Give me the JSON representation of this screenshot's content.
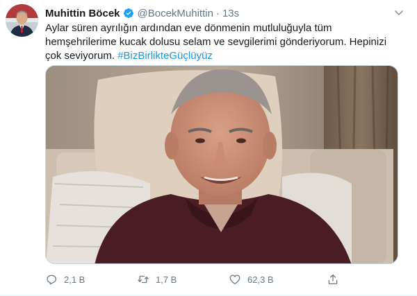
{
  "user": {
    "name": "Muhittin Böcek",
    "handle": "@BocekMuhittin",
    "separator": "·",
    "time": "13s"
  },
  "tweet": {
    "line1": "Aylar süren ayrılığın ardından eve dönmenin mutluluğuyla tüm",
    "line2": "hemşehrilerime kucak dolusu selam ve sevgilerimi gönderiyorum. Hepinizi",
    "line3": "çok seviyorum.",
    "hashtag": "#BizBirlikteGüçlüyüz"
  },
  "actions": {
    "reply_count": "2,1 B",
    "retweet_count": "1,7 B",
    "like_count": "62,3 B"
  },
  "icons": {
    "verified": "verified-badge-icon",
    "caret": "chevron-down-icon",
    "reply": "reply-icon",
    "retweet": "retweet-icon",
    "like": "heart-icon",
    "share": "share-icon"
  },
  "colors": {
    "link": "#1b95e0",
    "muted": "#657786",
    "verified": "#1da1f2"
  }
}
